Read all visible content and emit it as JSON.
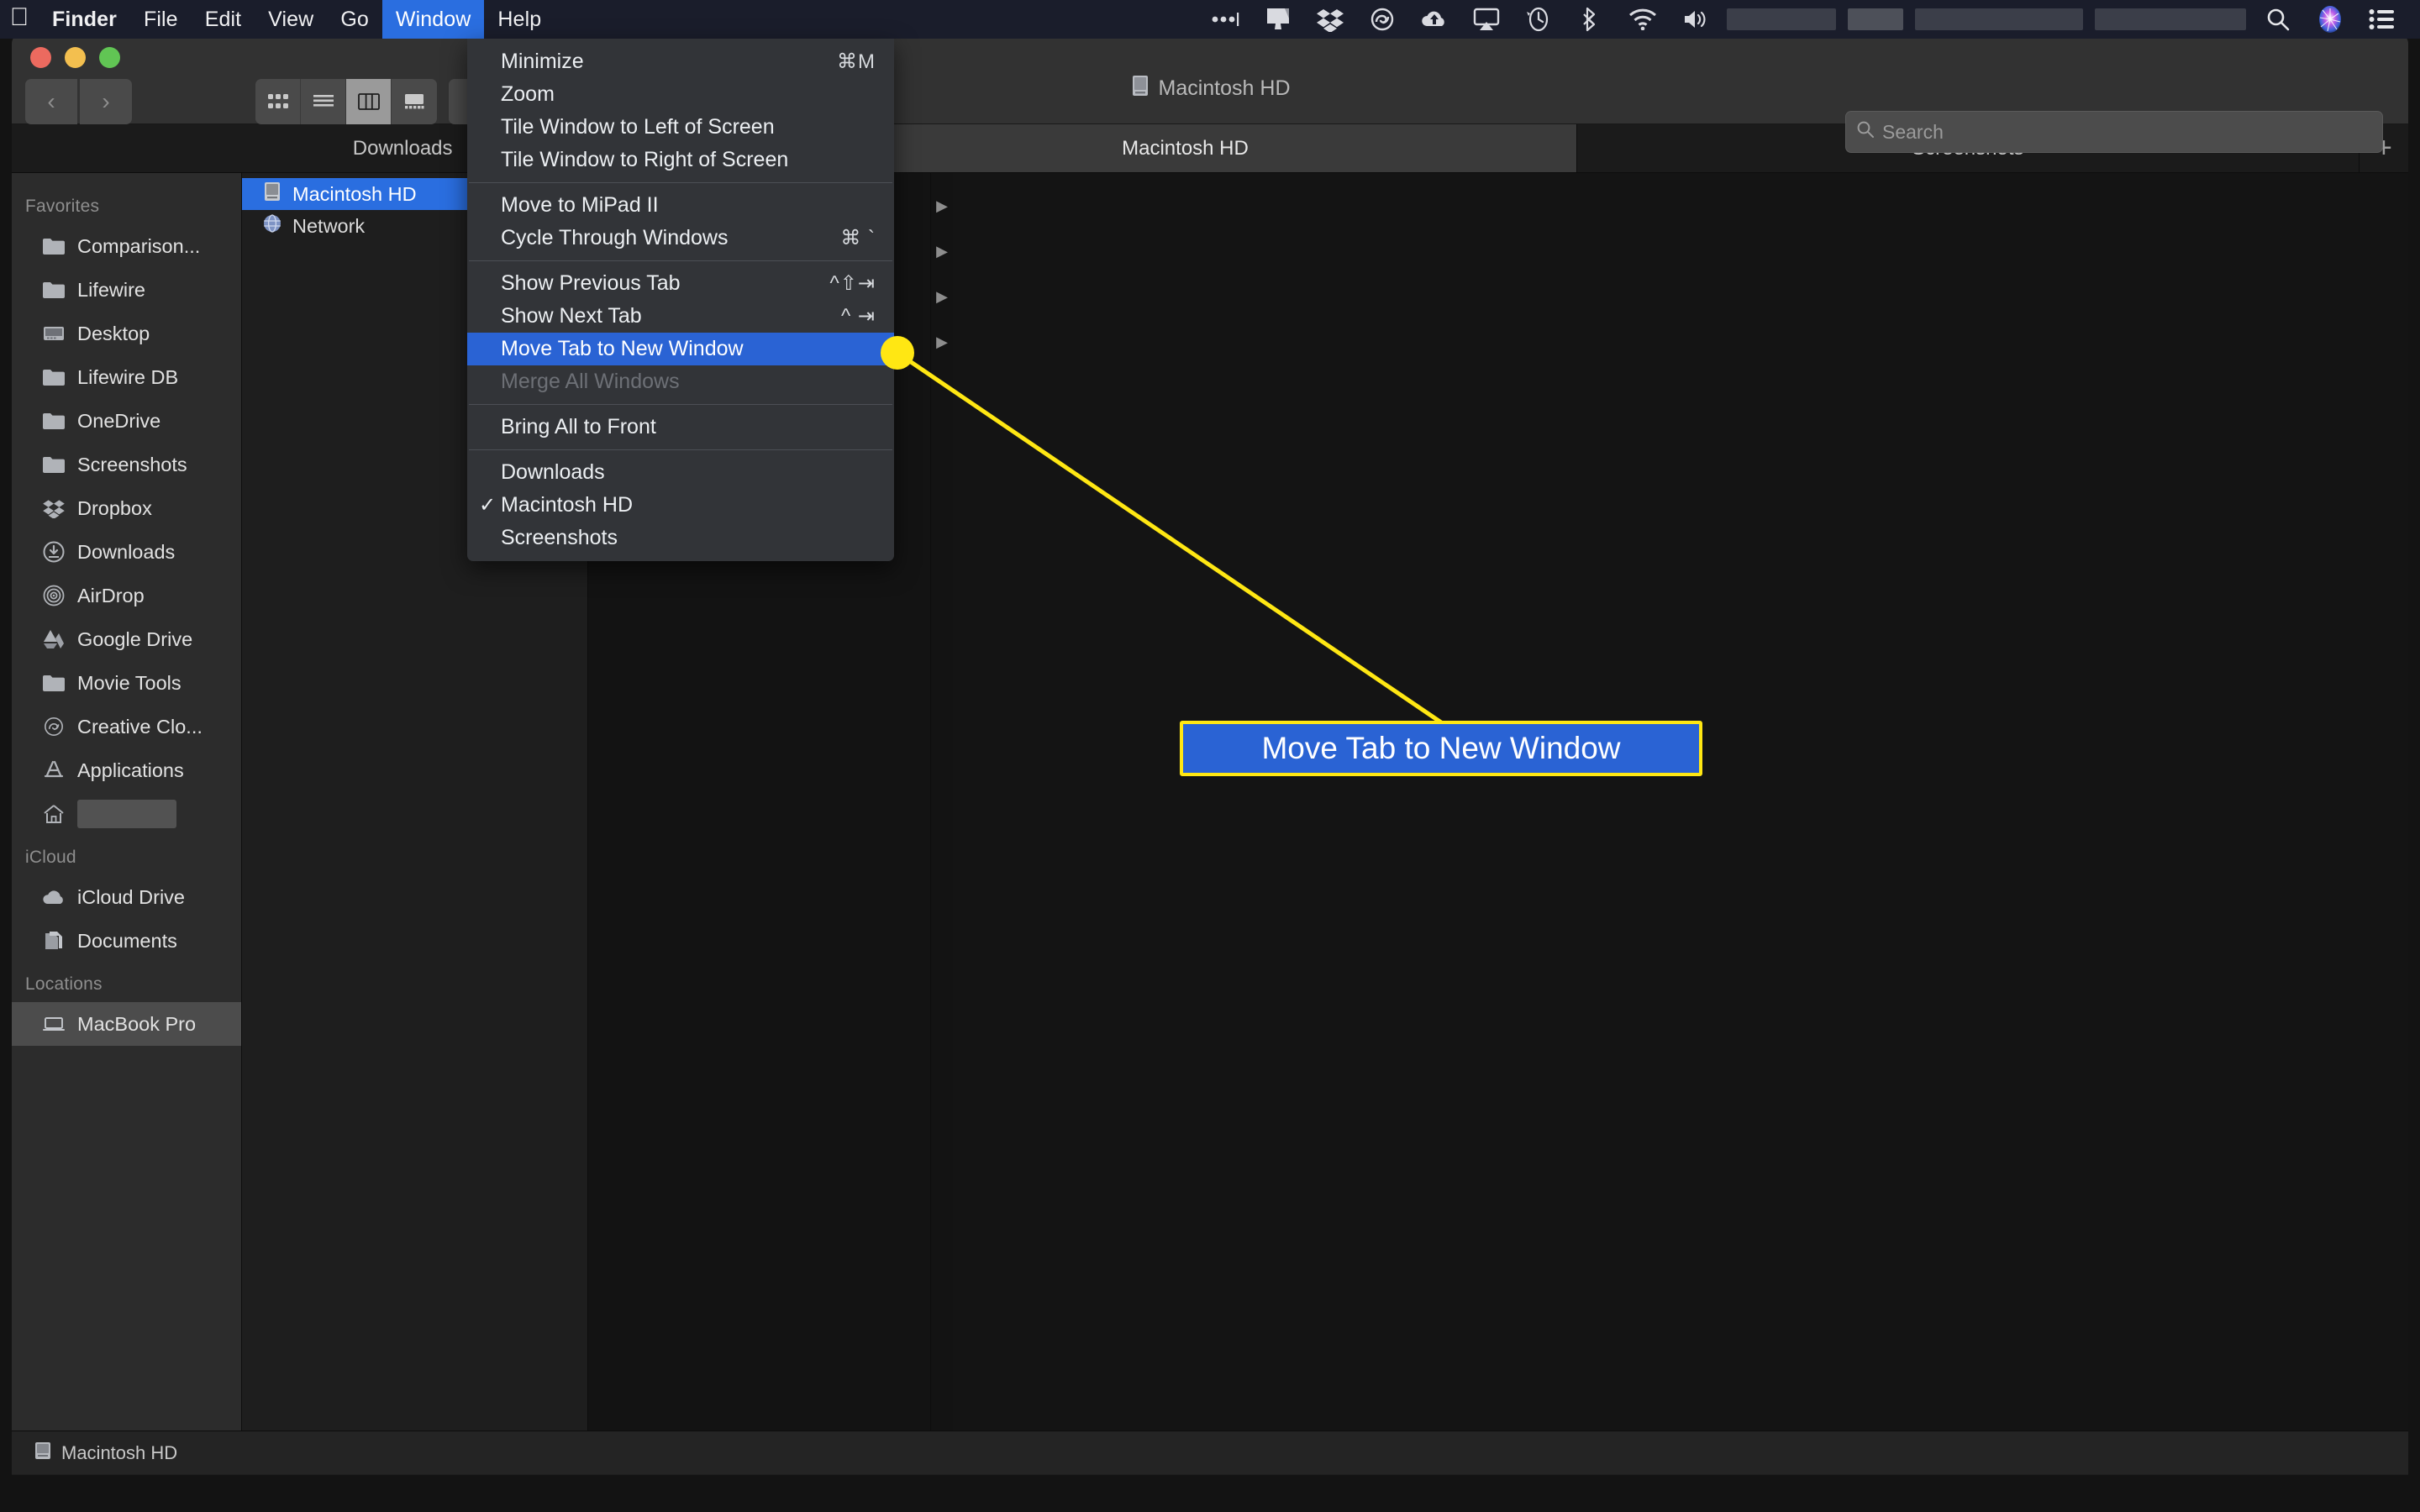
{
  "menubar": {
    "apple_icon": "apple-logo-icon",
    "items": [
      {
        "label": "Finder",
        "bold": true,
        "active": false
      },
      {
        "label": "File",
        "bold": false,
        "active": false
      },
      {
        "label": "Edit",
        "bold": false,
        "active": false
      },
      {
        "label": "View",
        "bold": false,
        "active": false
      },
      {
        "label": "Go",
        "bold": false,
        "active": false
      },
      {
        "label": "Window",
        "bold": false,
        "active": true
      },
      {
        "label": "Help",
        "bold": false,
        "active": false
      }
    ],
    "status_icons": [
      "ellipsis-menu-icon",
      "display-icon",
      "dropbox-icon",
      "creative-cloud-icon",
      "cloud-upload-icon",
      "airplay-icon",
      "time-machine-icon",
      "bluetooth-icon",
      "wifi-icon",
      "volume-icon"
    ],
    "right_icons": [
      "search-icon",
      "siri-icon",
      "control-center-icon"
    ],
    "accent_color": "#2a6ee0",
    "bar_color": "#1a1d2b"
  },
  "window": {
    "title": "Macintosh HD",
    "title_icon": "hard-drive-icon",
    "traffic_lights": [
      "close",
      "minimize",
      "maximize"
    ],
    "nav_back": "‹",
    "nav_forward": "›",
    "view_modes": [
      "icon-view",
      "list-view",
      "column-view",
      "gallery-view"
    ],
    "view_mode_selected": "column-view",
    "action_menu": "gear-icon"
  },
  "search": {
    "placeholder": "Search",
    "value": "",
    "icon": "search-icon"
  },
  "tabs": {
    "items": [
      {
        "label": "Downloads",
        "active": false
      },
      {
        "label": "Macintosh HD",
        "active": true
      },
      {
        "label": "Screenshots",
        "active": false
      }
    ],
    "add_label": "+"
  },
  "sidebar": {
    "sections": [
      {
        "header": "Favorites",
        "items": [
          {
            "label": "Comparison...",
            "icon": "folder-icon",
            "selected": false
          },
          {
            "label": "Lifewire",
            "icon": "folder-icon",
            "selected": false
          },
          {
            "label": "Desktop",
            "icon": "desktop-icon",
            "selected": false
          },
          {
            "label": "Lifewire DB",
            "icon": "folder-icon",
            "selected": false
          },
          {
            "label": "OneDrive",
            "icon": "folder-icon",
            "selected": false
          },
          {
            "label": "Screenshots",
            "icon": "folder-icon",
            "selected": false
          },
          {
            "label": "Dropbox",
            "icon": "dropbox-icon",
            "selected": false
          },
          {
            "label": "Downloads",
            "icon": "download-circle-icon",
            "selected": false
          },
          {
            "label": "AirDrop",
            "icon": "airdrop-icon",
            "selected": false
          },
          {
            "label": "Google Drive",
            "icon": "google-drive-icon",
            "selected": false
          },
          {
            "label": "Movie Tools",
            "icon": "folder-icon",
            "selected": false
          },
          {
            "label": "Creative Clo...",
            "icon": "creative-cloud-icon",
            "selected": false
          },
          {
            "label": "Applications",
            "icon": "app-store-icon",
            "selected": false
          },
          {
            "label": "",
            "icon": "home-icon",
            "selected": false,
            "redacted": true
          }
        ]
      },
      {
        "header": "iCloud",
        "items": [
          {
            "label": "iCloud Drive",
            "icon": "cloud-icon",
            "selected": false
          },
          {
            "label": "Documents",
            "icon": "documents-icon",
            "selected": false
          }
        ]
      },
      {
        "header": "Locations",
        "items": [
          {
            "label": "MacBook Pro",
            "icon": "laptop-icon",
            "selected": true
          }
        ]
      }
    ]
  },
  "filelist": {
    "rows": [
      {
        "label": "Macintosh HD",
        "icon": "hard-drive-icon",
        "selected": true
      },
      {
        "label": "Network",
        "icon": "network-globe-icon",
        "selected": false
      }
    ]
  },
  "column_arrows": [
    "▶",
    "▶",
    "▶",
    "▶"
  ],
  "window_menu": {
    "groups": [
      [
        {
          "label": "Minimize",
          "shortcut": "⌘M",
          "highlighted": false,
          "disabled": false,
          "checked": false
        },
        {
          "label": "Zoom",
          "shortcut": "",
          "highlighted": false,
          "disabled": false,
          "checked": false
        },
        {
          "label": "Tile Window to Left of Screen",
          "shortcut": "",
          "highlighted": false,
          "disabled": false,
          "checked": false
        },
        {
          "label": "Tile Window to Right of Screen",
          "shortcut": "",
          "highlighted": false,
          "disabled": false,
          "checked": false
        }
      ],
      [
        {
          "label": "Move to MiPad II",
          "shortcut": "",
          "highlighted": false,
          "disabled": false,
          "checked": false
        },
        {
          "label": "Cycle Through Windows",
          "shortcut": "⌘ `",
          "highlighted": false,
          "disabled": false,
          "checked": false
        }
      ],
      [
        {
          "label": "Show Previous Tab",
          "shortcut": "^⇧⇥",
          "highlighted": false,
          "disabled": false,
          "checked": false
        },
        {
          "label": "Show Next Tab",
          "shortcut": "^ ⇥",
          "highlighted": false,
          "disabled": false,
          "checked": false
        },
        {
          "label": "Move Tab to New Window",
          "shortcut": "",
          "highlighted": true,
          "disabled": false,
          "checked": false
        },
        {
          "label": "Merge All Windows",
          "shortcut": "",
          "highlighted": false,
          "disabled": true,
          "checked": false
        }
      ],
      [
        {
          "label": "Bring All to Front",
          "shortcut": "",
          "highlighted": false,
          "disabled": false,
          "checked": false
        }
      ],
      [
        {
          "label": "Downloads",
          "shortcut": "",
          "highlighted": false,
          "disabled": false,
          "checked": false
        },
        {
          "label": "Macintosh HD",
          "shortcut": "",
          "highlighted": false,
          "disabled": false,
          "checked": true
        },
        {
          "label": "Screenshots",
          "shortcut": "",
          "highlighted": false,
          "disabled": false,
          "checked": false
        }
      ]
    ]
  },
  "statusbar": {
    "label": "Macintosh HD",
    "icon": "hard-drive-icon"
  },
  "annotation": {
    "callout_text": "Move Tab to New Window",
    "highlight_color": "#ffe713",
    "box_fill": "#2a63d4",
    "dot_label": "callout-anchor-dot"
  }
}
